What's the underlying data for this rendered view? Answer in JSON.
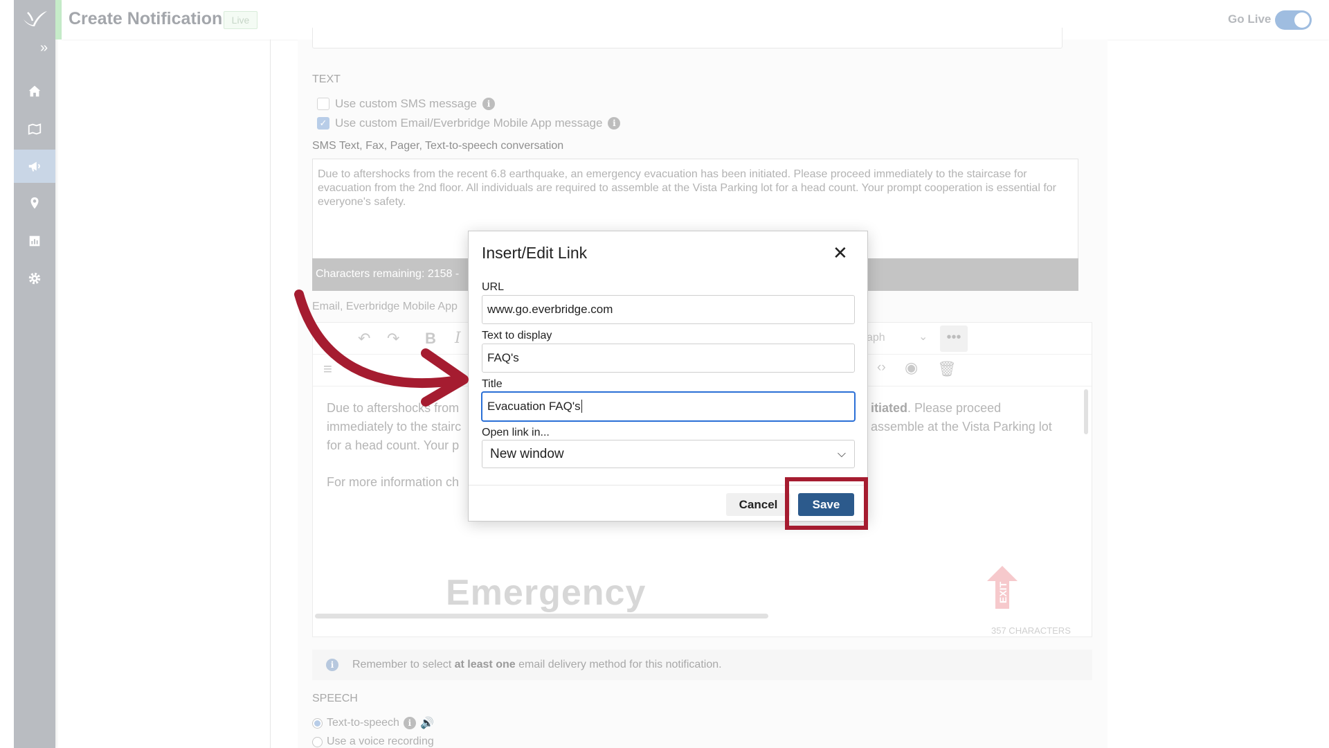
{
  "header": {
    "title": "Create Notification",
    "live_badge": "Live",
    "go_live_label": "Go Live",
    "go_live_on": true
  },
  "sidebar": {
    "items": [
      {
        "icon": "home-icon",
        "active": false
      },
      {
        "icon": "map-icon",
        "active": false
      },
      {
        "icon": "megaphone-icon",
        "active": true
      },
      {
        "icon": "location-pin-icon",
        "active": false
      },
      {
        "icon": "report-icon",
        "active": false
      },
      {
        "icon": "gear-icon",
        "active": false
      }
    ]
  },
  "text_section": {
    "label": "TEXT",
    "custom_sms_label": "Use custom SMS message",
    "custom_sms_checked": false,
    "custom_email_label": "Use custom Email/Everbridge Mobile App message",
    "custom_email_checked": true,
    "sms_label": "SMS Text, Fax, Pager, Text-to-speech conversation",
    "sms_text": "Due to aftershocks from the recent 6.8 earthquake, an emergency evacuation has been initiated. Please proceed immediately to the staircase for evacuation from the 2nd floor. All individuals are required to assemble at the Vista Parking lot for a head count. Your prompt cooperation is essential for everyone's safety.",
    "chars_remaining": "Characters remaining: 2158 -",
    "email_label": "Email, Everbridge Mobile App"
  },
  "editor": {
    "paragraph_select": "aph",
    "body_left": "Due to aftershocks from",
    "body_left_2": "immediately to the stairc",
    "body_left_3": "for a head count. Your p",
    "body_right_bold": "itiated",
    "body_right_rest": ". Please proceed",
    "body_right_2": "assemble at the Vista Parking lot",
    "more_info": "For more information ch",
    "image_text": "Emergency",
    "exit_text": "EXIT",
    "char_count": "357 CHARACTERS"
  },
  "notice": {
    "pre": "Remember to select ",
    "bold": "at least one",
    "post": " email delivery method for this notification."
  },
  "speech": {
    "label": "SPEECH",
    "tts_label": "Text-to-speech",
    "voice_label": "Use a voice recording"
  },
  "modal": {
    "title": "Insert/Edit Link",
    "url_label": "URL",
    "url_value": "www.go.everbridge.com",
    "display_label": "Text to display",
    "display_value": "FAQ's",
    "title_label": "Title",
    "title_value": "Evacuation FAQ's",
    "open_label": "Open link in...",
    "open_value": "New window",
    "cancel_label": "Cancel",
    "save_label": "Save"
  },
  "colors": {
    "annotation": "#a51c30",
    "save_button": "#2c5a8c",
    "focus": "#2a6fd6"
  }
}
